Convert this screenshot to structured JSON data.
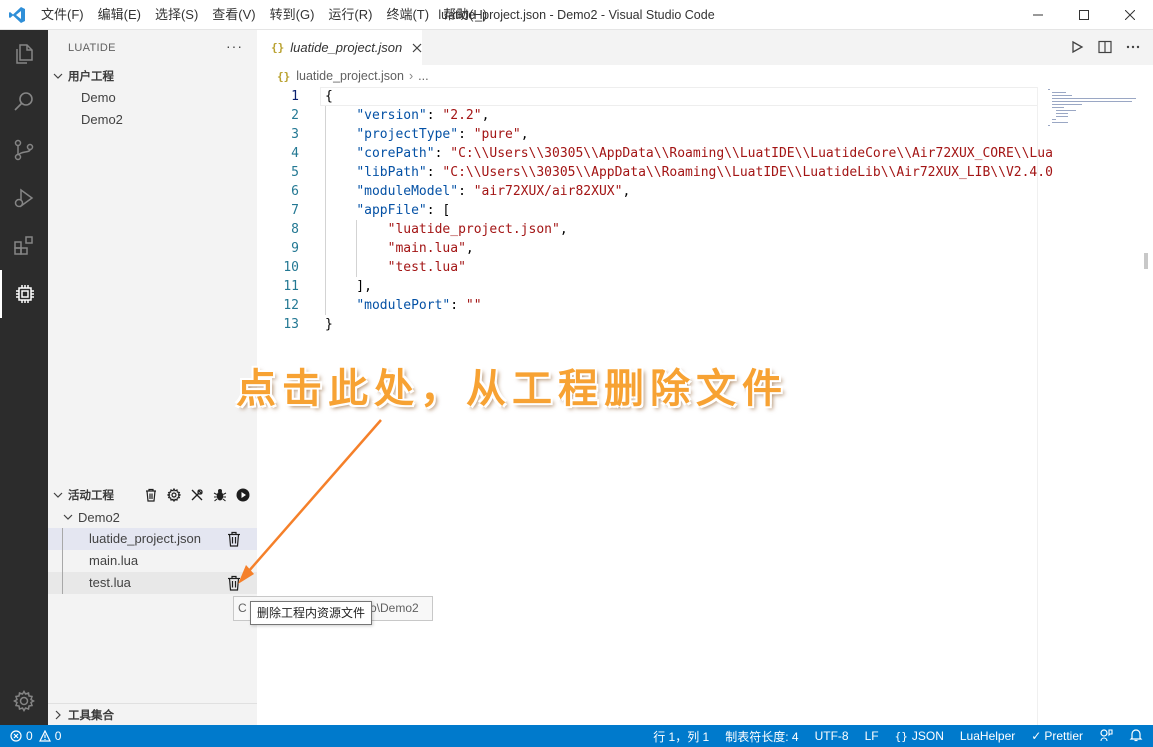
{
  "window": {
    "title": "luatide_project.json - Demo2 - Visual Studio Code",
    "menu": [
      "文件(F)",
      "编辑(E)",
      "选择(S)",
      "查看(V)",
      "转到(G)",
      "运行(R)",
      "终端(T)",
      "帮助(H)"
    ]
  },
  "sidebar": {
    "title": "LUATIDE",
    "more": "···",
    "user_projects": {
      "label": "用户工程",
      "items": [
        "Demo",
        "Demo2"
      ]
    },
    "active_project": {
      "label": "活动工程",
      "project": "Demo2",
      "files": [
        "luatide_project.json",
        "main.lua",
        "test.lua"
      ]
    },
    "tools": {
      "label": "工具集合"
    }
  },
  "editor": {
    "tab_label": "luatide_project.json",
    "tab_icon": "{}",
    "breadcrumb_file": "luatide_project.json",
    "breadcrumb_more": "...",
    "lines": [
      {
        "n": "1",
        "segs": [
          {
            "c": "p",
            "t": "{"
          }
        ]
      },
      {
        "n": "2",
        "segs": [
          {
            "c": "p",
            "t": "    "
          },
          {
            "c": "k",
            "t": "\"version\""
          },
          {
            "c": "p",
            "t": ": "
          },
          {
            "c": "s",
            "t": "\"2.2\""
          },
          {
            "c": "p",
            "t": ","
          }
        ]
      },
      {
        "n": "3",
        "segs": [
          {
            "c": "p",
            "t": "    "
          },
          {
            "c": "k",
            "t": "\"projectType\""
          },
          {
            "c": "p",
            "t": ": "
          },
          {
            "c": "s",
            "t": "\"pure\""
          },
          {
            "c": "p",
            "t": ","
          }
        ]
      },
      {
        "n": "4",
        "segs": [
          {
            "c": "p",
            "t": "    "
          },
          {
            "c": "k",
            "t": "\"corePath\""
          },
          {
            "c": "p",
            "t": ": "
          },
          {
            "c": "s",
            "t": "\"C:\\\\Users\\\\30305\\\\AppData\\\\Roaming\\\\LuatIDE\\\\LuatideCore\\\\Air72XUX_CORE\\\\Lua"
          }
        ]
      },
      {
        "n": "5",
        "segs": [
          {
            "c": "p",
            "t": "    "
          },
          {
            "c": "k",
            "t": "\"libPath\""
          },
          {
            "c": "p",
            "t": ": "
          },
          {
            "c": "s",
            "t": "\"C:\\\\Users\\\\30305\\\\AppData\\\\Roaming\\\\LuatIDE\\\\LuatideLib\\\\Air72XUX_LIB\\\\V2.4.0"
          }
        ]
      },
      {
        "n": "6",
        "segs": [
          {
            "c": "p",
            "t": "    "
          },
          {
            "c": "k",
            "t": "\"moduleModel\""
          },
          {
            "c": "p",
            "t": ": "
          },
          {
            "c": "s",
            "t": "\"air72XUX/air82XUX\""
          },
          {
            "c": "p",
            "t": ","
          }
        ]
      },
      {
        "n": "7",
        "segs": [
          {
            "c": "p",
            "t": "    "
          },
          {
            "c": "k",
            "t": "\"appFile\""
          },
          {
            "c": "p",
            "t": ": ["
          }
        ]
      },
      {
        "n": "8",
        "segs": [
          {
            "c": "p",
            "t": "        "
          },
          {
            "c": "s",
            "t": "\"luatide_project.json\""
          },
          {
            "c": "p",
            "t": ","
          }
        ]
      },
      {
        "n": "9",
        "segs": [
          {
            "c": "p",
            "t": "        "
          },
          {
            "c": "s",
            "t": "\"main.lua\""
          },
          {
            "c": "p",
            "t": ","
          }
        ]
      },
      {
        "n": "10",
        "segs": [
          {
            "c": "p",
            "t": "        "
          },
          {
            "c": "s",
            "t": "\"test.lua\""
          }
        ]
      },
      {
        "n": "11",
        "segs": [
          {
            "c": "p",
            "t": "    ],"
          }
        ]
      },
      {
        "n": "12",
        "segs": [
          {
            "c": "p",
            "t": "    "
          },
          {
            "c": "k",
            "t": "\"modulePort\""
          },
          {
            "c": "p",
            "t": ": "
          },
          {
            "c": "s",
            "t": "\"\""
          }
        ]
      },
      {
        "n": "13",
        "segs": [
          {
            "c": "p",
            "t": "}"
          }
        ]
      }
    ]
  },
  "annotation": "点击此处，从工程删除文件",
  "hover_path": "C:\\Users\\30305\\Desktop\\Demo2",
  "hover_path_visible": "o\\Demo2",
  "tooltip": "删除工程内资源文件",
  "statusbar": {
    "errors": "0",
    "warnings": "0",
    "position": "行 1，列 1",
    "tab_size": "制表符长度: 4",
    "encoding": "UTF-8",
    "eol": "LF",
    "language": "JSON",
    "language_icon": "{}",
    "helper": "LuaHelper",
    "prettier": "Prettier"
  },
  "colors": {
    "accent": "#007acc",
    "annotation": "#f7a233",
    "activity_bar": "#2c2c2c"
  }
}
